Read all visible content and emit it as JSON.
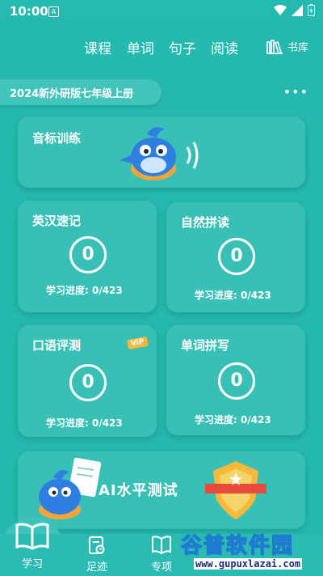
{
  "status": {
    "time": "10:00",
    "sim_label": "A"
  },
  "nav": {
    "tabs": [
      "课程",
      "单词",
      "句子",
      "阅读"
    ],
    "library": "书库"
  },
  "book": {
    "title": "2024新外研版七年级上册",
    "more": "•••"
  },
  "phonics": {
    "title": "音标训练"
  },
  "cards": [
    {
      "title": "英汉速记",
      "count": "0",
      "progress": "学习进度: 0/423"
    },
    {
      "title": "自然拼读",
      "count": "0",
      "progress": "学习进度: 0/423"
    },
    {
      "title": "口语评测",
      "count": "0",
      "progress": "学习进度: 0/423",
      "badge": "ViP"
    },
    {
      "title": "单词拼写",
      "count": "0",
      "progress": "学习进度: 0/423"
    }
  ],
  "ai_test": {
    "title": "AI水平测试"
  },
  "bottom_tabs": [
    {
      "label": "学习",
      "icon": "book-icon",
      "active": true
    },
    {
      "label": "足迹",
      "icon": "footprint-doc-icon"
    },
    {
      "label": "专项",
      "icon": "special-book-icon"
    }
  ],
  "watermark": {
    "brand": "谷普软件园",
    "url": "www.gupuxlazai.com"
  },
  "colors": {
    "background": "#24b8ae",
    "card": "#38c0b7",
    "accent_gold": "#f7b93a",
    "accent_red": "#e94a3c"
  }
}
